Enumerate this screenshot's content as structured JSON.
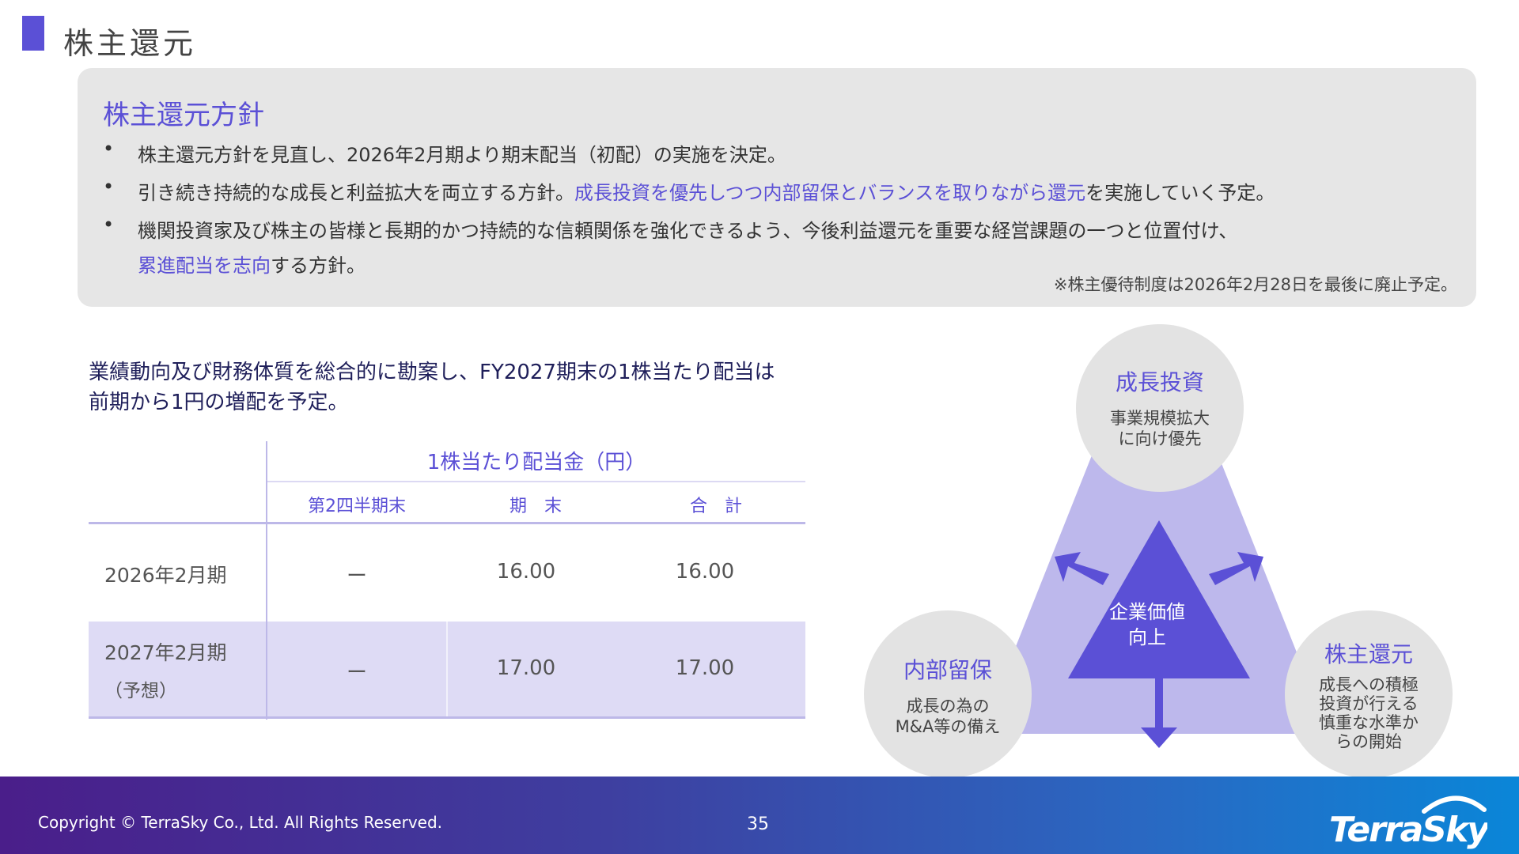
{
  "slide": {
    "title": "株主還元",
    "page_number": "35",
    "copyright": "Copyright © TerraSky Co., Ltd. All Rights Reserved.",
    "logo_text": "TerraSky"
  },
  "policy": {
    "title": "株主還元方針",
    "bullet": "•",
    "b1": "株主還元方針を見直し、2026年2月期より期末配当（初配）の実施を決定。",
    "b2_pre": "引き続き持続的な成長と利益拡大を両立する方針。",
    "b2_hl": "成長投資を優先しつつ内部留保とバランスを取りながら還元",
    "b2_post": "を実施していく予定。",
    "b3_pre": "機関投資家及び株主の皆様と長期的かつ持続的な信頼関係を強化できるよう、今後利益還元を重要な経営課題の一つと位置付け、",
    "b3_hl": "累進配当を志向",
    "b3_post": "する方針。",
    "note": "※株主優待制度は2026年2月28日を最後に廃止予定。"
  },
  "summary": {
    "line1": "業績動向及び財務体質を総合的に勘案し、FY2027期末の1株当たり配当は",
    "line2": "前期から1円の増配を予定。"
  },
  "dividend_table": {
    "group_header": "1株当たり配当金（円）",
    "columns": [
      "第2四半期末",
      "期　末",
      "合　計"
    ],
    "rows": [
      {
        "label": "2026年2月期",
        "sub": "",
        "q2": "ー",
        "year_end": "16.00",
        "total": "16.00"
      },
      {
        "label": "2027年2月期",
        "sub": "（予想）",
        "q2": "ー",
        "year_end": "17.00",
        "total": "17.00"
      }
    ]
  },
  "diagram": {
    "center": {
      "line1": "企業価値",
      "line2": "向上"
    },
    "top": {
      "title": "成長投資",
      "line1": "事業規模拡大",
      "line2": "に向け優先"
    },
    "left": {
      "title": "内部留保",
      "line1": "成長の為の",
      "line2": "M&A等の備え"
    },
    "right": {
      "title": "株主還元",
      "line1": "成長への積極",
      "line2": "投資が行える",
      "line3": "慎重な水準か",
      "line4": "らの開始"
    },
    "colors": {
      "triangle_light": "#bdb8ec",
      "triangle_dark": "#5b50d6",
      "circle": "#e3e3e3"
    }
  },
  "colors": {
    "accent": "#5b50d6",
    "box_bg": "#e6e6e6",
    "row_highlight": "#dedbf5"
  }
}
